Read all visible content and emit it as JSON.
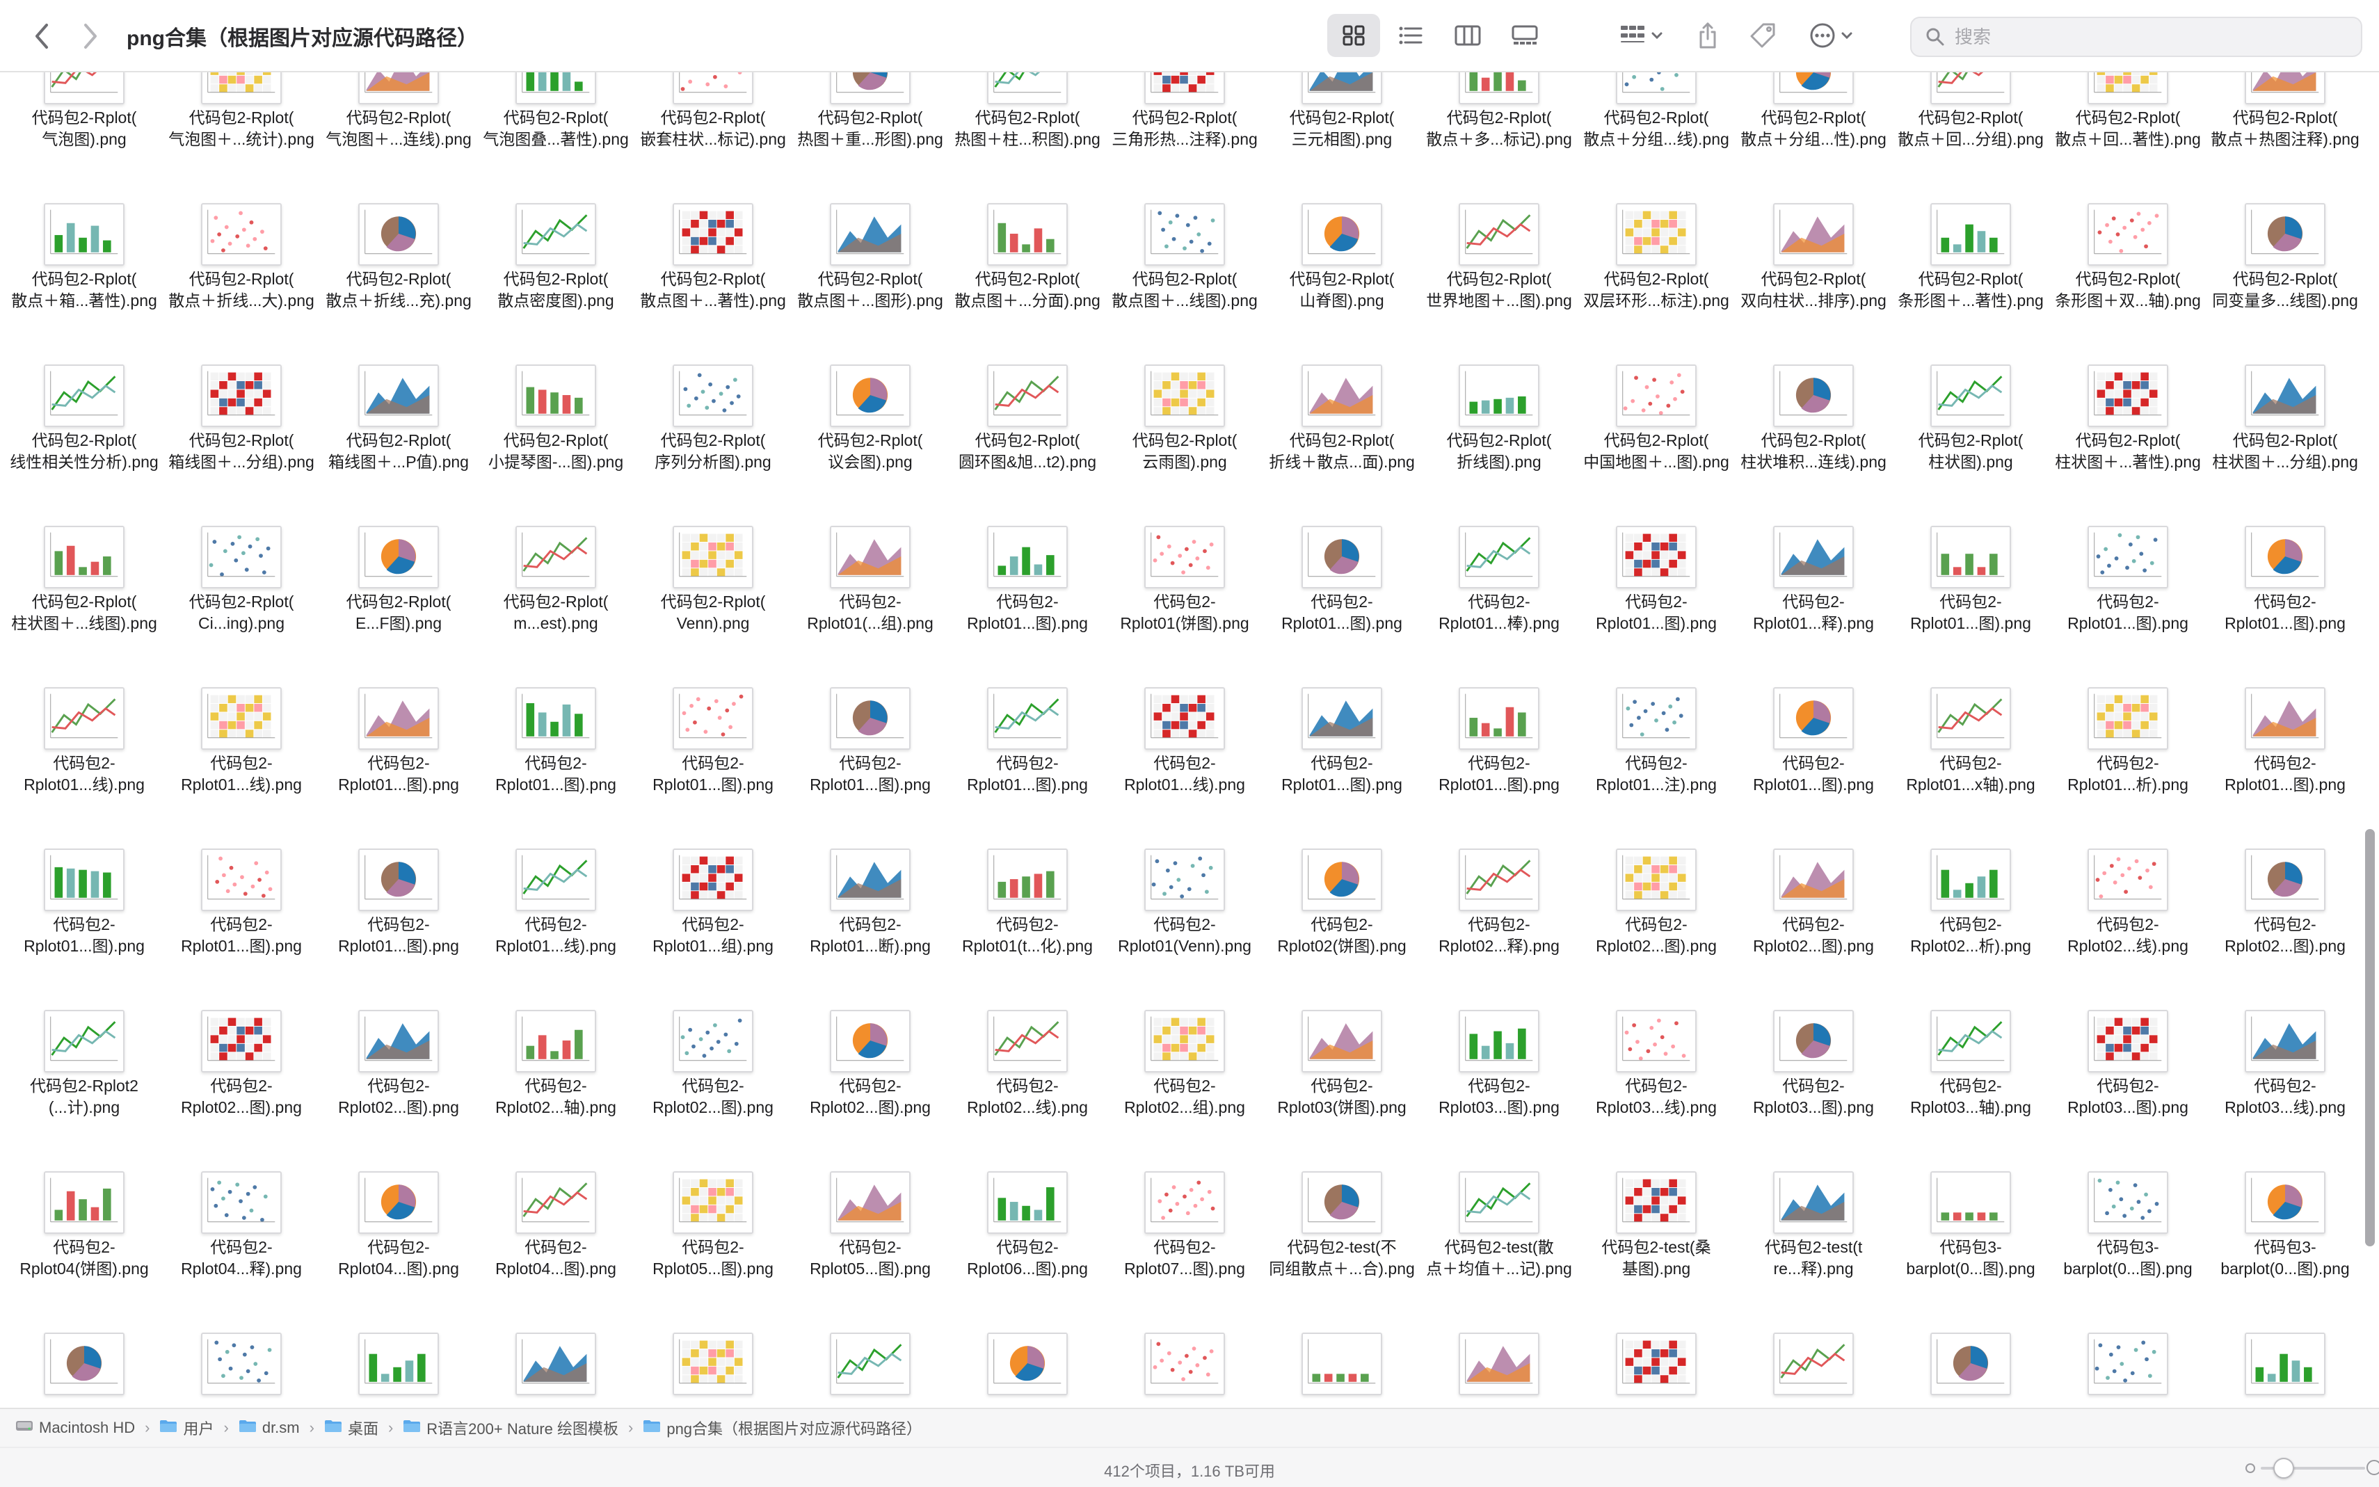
{
  "window": {
    "title": "png合集（根据图片对应源代码路径）",
    "search_placeholder": "搜索"
  },
  "toolbar": {
    "icons": [
      "chevron-left-icon",
      "chevron-right-icon",
      "grid-view-icon",
      "list-view-icon",
      "column-view-icon",
      "gallery-view-icon",
      "group-by-icon",
      "share-icon",
      "tag-icon",
      "more-icon",
      "search-icon"
    ],
    "active_view": "grid"
  },
  "grid": {
    "rows": [
      [
        "代码包2-Rplot(气泡图).png",
        "代码包2-Rplot(气泡图＋...统计).png",
        "代码包2-Rplot(气泡图＋...连线).png",
        "代码包2-Rplot(气泡图叠...著性).png",
        "代码包2-Rplot(嵌套柱状...标记).png",
        "代码包2-Rplot(热图＋重...形图).png",
        "代码包2-Rplot(热图＋柱...积图).png",
        "代码包2-Rplot(三角形热...注释).png",
        "代码包2-Rplot(三元相图).png",
        "代码包2-Rplot(散点＋多...标记).png",
        "代码包2-Rplot(散点＋分组...线).png",
        "代码包2-Rplot(散点＋分组...性).png",
        "代码包2-Rplot(散点＋回...分组).png",
        "代码包2-Rplot(散点＋回...著性).png",
        "代码包2-Rplot(散点＋热图注释).png"
      ],
      [
        "代码包2-Rplot(散点＋箱...著性).png",
        "代码包2-Rplot(散点＋折线...大).png",
        "代码包2-Rplot(散点＋折线...充).png",
        "代码包2-Rplot(散点密度图).png",
        "代码包2-Rplot(散点图＋...著性).png",
        "代码包2-Rplot(散点图＋...图形).png",
        "代码包2-Rplot(散点图＋...分面).png",
        "代码包2-Rplot(散点图＋...线图).png",
        "代码包2-Rplot(山脊图).png",
        "代码包2-Rplot(世界地图＋...图).png",
        "代码包2-Rplot(双层环形...标注).png",
        "代码包2-Rplot(双向柱状...排序).png",
        "代码包2-Rplot(条形图＋...著性).png",
        "代码包2-Rplot(条形图＋双...轴).png",
        "代码包2-Rplot(同变量多...线图).png"
      ],
      [
        "代码包2-Rplot(线性相关性分析).png",
        "代码包2-Rplot(箱线图＋...分组).png",
        "代码包2-Rplot(箱线图＋...P值).png",
        "代码包2-Rplot(小提琴图-...图).png",
        "代码包2-Rplot(序列分析图).png",
        "代码包2-Rplot(议会图).png",
        "代码包2-Rplot(圆环图&旭...t2).png",
        "代码包2-Rplot(云雨图).png",
        "代码包2-Rplot(折线＋散点...面).png",
        "代码包2-Rplot(折线图).png",
        "代码包2-Rplot(中国地图＋...图).png",
        "代码包2-Rplot(柱状堆积...连线).png",
        "代码包2-Rplot(柱状图).png",
        "代码包2-Rplot(柱状图＋...著性).png",
        "代码包2-Rplot(柱状图＋...分组).png"
      ],
      [
        "代码包2-Rplot(柱状图＋...线图).png",
        "代码包2-Rplot(Ci...ing).png",
        "代码包2-Rplot(E...F图).png",
        "代码包2-Rplot(m...est).png",
        "代码包2-Rplot(Venn).png",
        "代码包2-Rplot01(...组).png",
        "代码包2-Rplot01...图).png",
        "代码包2-Rplot01(饼图).png",
        "代码包2-Rplot01...图).png",
        "代码包2-Rplot01...棒).png",
        "代码包2-Rplot01...图).png",
        "代码包2-Rplot01...释).png",
        "代码包2-Rplot01...图).png",
        "代码包2-Rplot01...图).png",
        "代码包2-Rplot01...图).png"
      ],
      [
        "代码包2-Rplot01...线).png",
        "代码包2-Rplot01...线).png",
        "代码包2-Rplot01...图).png",
        "代码包2-Rplot01...图).png",
        "代码包2-Rplot01...图).png",
        "代码包2-Rplot01...图).png",
        "代码包2-Rplot01...图).png",
        "代码包2-Rplot01...线).png",
        "代码包2-Rplot01...图).png",
        "代码包2-Rplot01...图).png",
        "代码包2-Rplot01...注).png",
        "代码包2-Rplot01...图).png",
        "代码包2-Rplot01...x轴).png",
        "代码包2-Rplot01...析).png",
        "代码包2-Rplot01...图).png"
      ],
      [
        "代码包2-Rplot01...图).png",
        "代码包2-Rplot01...图).png",
        "代码包2-Rplot01...图).png",
        "代码包2-Rplot01...线).png",
        "代码包2-Rplot01...组).png",
        "代码包2-Rplot01...断).png",
        "代码包2-Rplot01(t...化).png",
        "代码包2-Rplot01(Venn).png",
        "代码包2-Rplot02(饼图).png",
        "代码包2-Rplot02...释).png",
        "代码包2-Rplot02...图).png",
        "代码包2-Rplot02...图).png",
        "代码包2-Rplot02...析).png",
        "代码包2-Rplot02...线).png",
        "代码包2-Rplot02...图).png"
      ],
      [
        "代码包2-Rplot2(...计).png",
        "代码包2-Rplot02...图).png",
        "代码包2-Rplot02...图).png",
        "代码包2-Rplot02...轴).png",
        "代码包2-Rplot02...图).png",
        "代码包2-Rplot02...图).png",
        "代码包2-Rplot02...线).png",
        "代码包2-Rplot02...组).png",
        "代码包2-Rplot03(饼图).png",
        "代码包2-Rplot03...图).png",
        "代码包2-Rplot03...线).png",
        "代码包2-Rplot03...图).png",
        "代码包2-Rplot03...轴).png",
        "代码包2-Rplot03...图).png",
        "代码包2-Rplot03...线).png"
      ],
      [
        "代码包2-Rplot04(饼图).png",
        "代码包2-Rplot04...释).png",
        "代码包2-Rplot04...图).png",
        "代码包2-Rplot04...图).png",
        "代码包2-Rplot05...图).png",
        "代码包2-Rplot05...图).png",
        "代码包2-Rplot06...图).png",
        "代码包2-Rplot07...图).png",
        "代码包2-test(不同组散点＋...合).png",
        "代码包2-test(散点＋均值＋...记).png",
        "代码包2-test(桑基图).png",
        "代码包2-test(tre...释).png",
        "代码包3-barplot(0...图).png",
        "代码包3-barplot(0...图).png",
        "代码包3-barplot(0...图).png"
      ]
    ]
  },
  "pathbar": {
    "items": [
      {
        "label": "Macintosh HD",
        "icon": "disk-icon"
      },
      {
        "label": "用户",
        "icon": "folder-icon"
      },
      {
        "label": "dr.sm",
        "icon": "folder-icon"
      },
      {
        "label": "桌面",
        "icon": "folder-icon"
      },
      {
        "label": "R语言200+ Nature 绘图模板",
        "icon": "folder-icon"
      },
      {
        "label": "png合集（根据图片对应源代码路径）",
        "icon": "folder-icon"
      }
    ]
  },
  "status": {
    "text": "412个项目，1.16 TB可用"
  },
  "colors": {
    "folder": "#5aa9ec",
    "accent": "#0a84ff",
    "label_text": "#1d1d1f"
  }
}
